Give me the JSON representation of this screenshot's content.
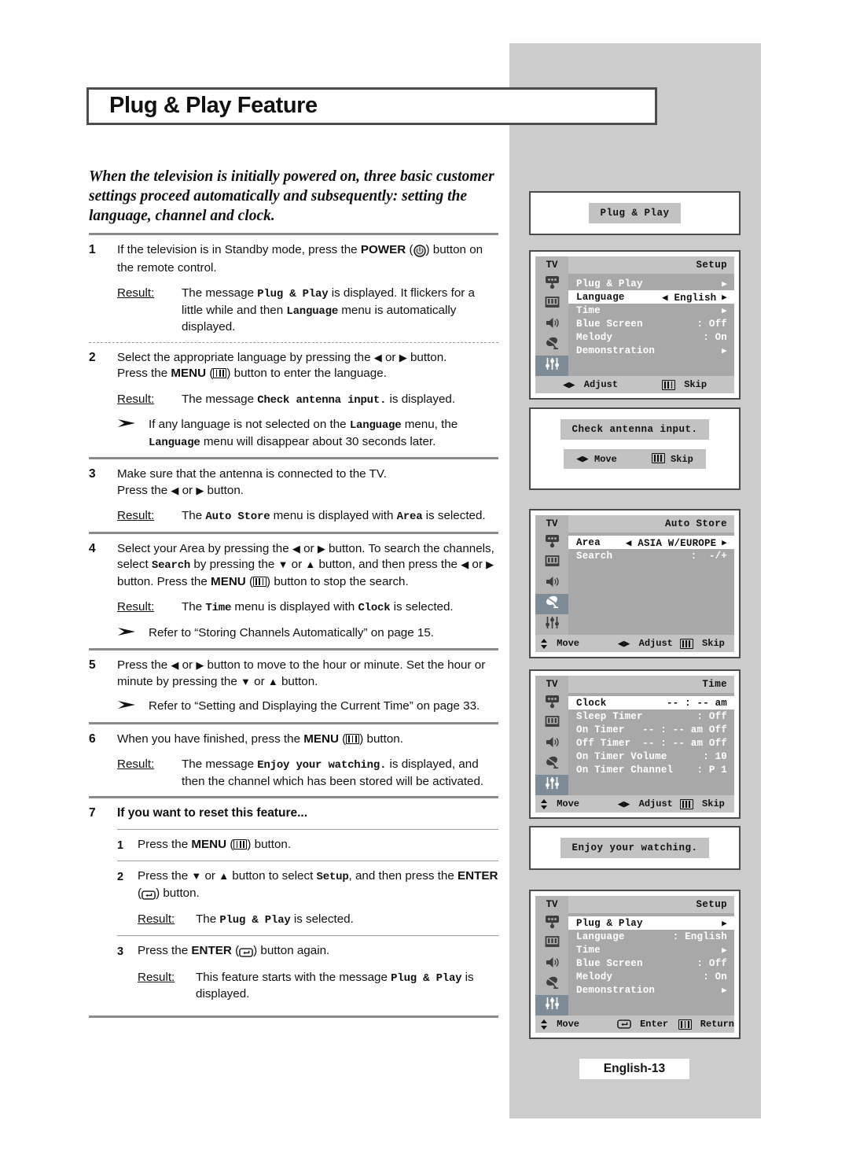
{
  "page": {
    "title": "Plug & Play Feature",
    "footer": "English-13",
    "intro": "When the television is initially powered on, three basic customer settings proceed automatically and subsequently: setting the language, channel and clock."
  },
  "icons": {
    "menu": "menu-icon",
    "enter": "enter-icon",
    "power": "power-icon",
    "left": "◀",
    "right": "▶",
    "up": "▲",
    "down": "▼",
    "updown": "↕",
    "note": "note-arrow-icon"
  },
  "steps": [
    {
      "num": "1",
      "text_a": "If the television is in Standby mode, press the ",
      "bold_a": "POWER",
      "icon_a": "power",
      "text_b": " button on the remote control.",
      "result_label": "Result:",
      "result_parts": [
        {
          "t": "The message ",
          "k": "n"
        },
        {
          "t": "Plug & Play",
          "k": "m"
        },
        {
          "t": " is displayed. It flickers for a little while and then ",
          "k": "n"
        },
        {
          "t": "Language",
          "k": "m"
        },
        {
          "t": " menu is automatically displayed.",
          "k": "n"
        }
      ]
    },
    {
      "num": "2",
      "line1_parts": [
        {
          "t": "Select the appropriate language by pressing the ",
          "k": "n"
        },
        {
          "t": "◀",
          "k": "a"
        },
        {
          "t": " or ",
          "k": "n"
        },
        {
          "t": "▶",
          "k": "a"
        },
        {
          "t": " button.",
          "k": "n"
        }
      ],
      "line2_pre": "Press the ",
      "line2_bold": "MENU",
      "line2_post": " button to enter the language.",
      "result_label": "Result:",
      "result_parts": [
        {
          "t": "The message ",
          "k": "n"
        },
        {
          "t": "Check antenna input.",
          "k": "m"
        },
        {
          "t": " is displayed.",
          "k": "n"
        }
      ],
      "note_parts": [
        {
          "t": "If any language is not selected on the ",
          "k": "n"
        },
        {
          "t": "Language",
          "k": "m"
        },
        {
          "t": " menu, the ",
          "k": "n"
        },
        {
          "t": "Language",
          "k": "m"
        },
        {
          "t": " menu will disappear about 30 seconds later.",
          "k": "n"
        }
      ]
    },
    {
      "num": "3",
      "line1": "Make sure that the antenna is connected to the TV.",
      "line2_parts": [
        {
          "t": "Press the ",
          "k": "n"
        },
        {
          "t": "◀",
          "k": "a"
        },
        {
          "t": " or ",
          "k": "n"
        },
        {
          "t": "▶",
          "k": "a"
        },
        {
          "t": " button.",
          "k": "n"
        }
      ],
      "result_label": "Result:",
      "result_parts": [
        {
          "t": "The ",
          "k": "n"
        },
        {
          "t": "Auto Store",
          "k": "m"
        },
        {
          "t": " menu is displayed with ",
          "k": "n"
        },
        {
          "t": "Area",
          "k": "m"
        },
        {
          "t": " is selected.",
          "k": "n"
        }
      ]
    },
    {
      "num": "4",
      "body_parts": [
        {
          "t": "Select your Area by pressing the ",
          "k": "n"
        },
        {
          "t": "◀",
          "k": "a"
        },
        {
          "t": " or ",
          "k": "n"
        },
        {
          "t": "▶",
          "k": "a"
        },
        {
          "t": " button. To search the channels, select ",
          "k": "n"
        },
        {
          "t": "Search",
          "k": "m"
        },
        {
          "t": " by pressing the ",
          "k": "n"
        },
        {
          "t": "▼",
          "k": "a"
        },
        {
          "t": " or ",
          "k": "n"
        },
        {
          "t": "▲",
          "k": "a"
        },
        {
          "t": " button, and then press the ",
          "k": "n"
        },
        {
          "t": "◀",
          "k": "a"
        },
        {
          "t": " or ",
          "k": "n"
        },
        {
          "t": "▶",
          "k": "a"
        },
        {
          "t": " button. Press the ",
          "k": "n"
        },
        {
          "t": "MENU",
          "k": "b"
        },
        {
          "t": "MENUICON",
          "k": "i"
        },
        {
          "t": " button to stop the search.",
          "k": "n"
        }
      ],
      "result_label": "Result:",
      "result_parts": [
        {
          "t": "The ",
          "k": "n"
        },
        {
          "t": "Time",
          "k": "m"
        },
        {
          "t": " menu is displayed with ",
          "k": "n"
        },
        {
          "t": "Clock",
          "k": "m"
        },
        {
          "t": " is selected.",
          "k": "n"
        }
      ],
      "note_parts": [
        {
          "t": "Refer to “Storing Channels Automatically” on page 15.",
          "k": "n"
        }
      ]
    },
    {
      "num": "5",
      "body_parts": [
        {
          "t": "Press the ",
          "k": "n"
        },
        {
          "t": "◀",
          "k": "a"
        },
        {
          "t": " or ",
          "k": "n"
        },
        {
          "t": "▶",
          "k": "a"
        },
        {
          "t": " button to move to the hour or minute. Set the hour or minute by pressing the ",
          "k": "n"
        },
        {
          "t": "▼",
          "k": "a"
        },
        {
          "t": " or ",
          "k": "n"
        },
        {
          "t": "▲",
          "k": "a"
        },
        {
          "t": " button.",
          "k": "n"
        }
      ],
      "note_parts": [
        {
          "t": "Refer to “Setting and Displaying the Current Time” on page 33.",
          "k": "n"
        }
      ]
    },
    {
      "num": "6",
      "body_pre": "When you have finished, press the ",
      "body_bold": "MENU",
      "body_post": " button.",
      "result_label": "Result:",
      "result_parts": [
        {
          "t": "The message ",
          "k": "n"
        },
        {
          "t": "Enjoy your watching.",
          "k": "m"
        },
        {
          "t": " is displayed, and then the channel which has been stored will be activated.",
          "k": "n"
        }
      ]
    }
  ],
  "step7": {
    "num": "7",
    "headline": "If you want to reset this feature...",
    "substeps": [
      {
        "num": "1",
        "pre": "Press the ",
        "bold": "MENU",
        "post": " button."
      },
      {
        "num": "2",
        "parts": [
          {
            "t": "Press the ",
            "k": "n"
          },
          {
            "t": "▼",
            "k": "a"
          },
          {
            "t": " or ",
            "k": "n"
          },
          {
            "t": "▲",
            "k": "a"
          },
          {
            "t": " button to select ",
            "k": "n"
          },
          {
            "t": "Setup",
            "k": "m"
          },
          {
            "t": ", and then press the ",
            "k": "n"
          },
          {
            "t": "ENTER",
            "k": "b"
          },
          {
            "t": "ENTERICON",
            "k": "i"
          },
          {
            "t": " button.",
            "k": "n"
          }
        ],
        "result_label": "Result:",
        "result_parts": [
          {
            "t": "The ",
            "k": "n"
          },
          {
            "t": "Plug & Play",
            "k": "m"
          },
          {
            "t": " is selected.",
            "k": "n"
          }
        ]
      },
      {
        "num": "3",
        "parts": [
          {
            "t": "Press the ",
            "k": "n"
          },
          {
            "t": "ENTER",
            "k": "b"
          },
          {
            "t": "ENTERICON",
            "k": "i"
          },
          {
            "t": " button again.",
            "k": "n"
          }
        ],
        "result_label": "Result:",
        "result_parts": [
          {
            "t": "This feature starts with the message ",
            "k": "n"
          },
          {
            "t": "Plug & Play",
            "k": "m"
          },
          {
            "t": " is displayed.",
            "k": "n"
          }
        ]
      }
    ]
  },
  "osd": {
    "plug_play_msg": {
      "message": "Plug & Play"
    },
    "setup_menu_1": {
      "tv_label": "TV",
      "title": "Setup",
      "rows": [
        {
          "label": "Plug & Play",
          "value": "",
          "caret": "▶",
          "highlight": false
        },
        {
          "label": "Language",
          "value": "◀ English",
          "caret": "▶",
          "highlight": true
        },
        {
          "label": "Time",
          "value": "",
          "caret": "▶",
          "highlight": false
        },
        {
          "label": "Blue Screen",
          "value": ": Off",
          "caret": "",
          "highlight": false
        },
        {
          "label": "Melody",
          "value": ": On",
          "caret": "",
          "highlight": false
        },
        {
          "label": "Demonstration",
          "value": "",
          "caret": "▶",
          "highlight": false
        }
      ],
      "selected_rail": 4,
      "footer": [
        {
          "icon": "◀▶",
          "label": "Adjust"
        },
        {
          "icon": "menu",
          "label": "Skip"
        }
      ]
    },
    "check_antenna": {
      "message": "Check antenna input.",
      "footer": [
        {
          "icon": "◀▶",
          "label": "Move"
        },
        {
          "icon": "menu",
          "label": "Skip"
        }
      ]
    },
    "auto_store_menu": {
      "tv_label": "TV",
      "title": "Auto Store",
      "rows": [
        {
          "label": "Area",
          "value": "◀ ASIA W/EUROPE",
          "caret": "▶",
          "highlight": true
        },
        {
          "label": "Search",
          "value": ":  -/+",
          "caret": "",
          "highlight": false
        }
      ],
      "selected_rail": 3,
      "footer": [
        {
          "icon": "↕",
          "label": "Move"
        },
        {
          "icon": "◀▶",
          "label": "Adjust"
        },
        {
          "icon": "menu",
          "label": "Skip"
        }
      ]
    },
    "time_menu": {
      "tv_label": "TV",
      "title": "Time",
      "rows": [
        {
          "label": "Clock",
          "value": "-- : -- am",
          "caret": "",
          "highlight": true
        },
        {
          "label": "Sleep Timer",
          "value": ": Off",
          "caret": "",
          "highlight": false
        },
        {
          "label": "On Timer",
          "value": "-- : -- am Off",
          "caret": "",
          "highlight": false
        },
        {
          "label": "Off Timer",
          "value": "-- : -- am Off",
          "caret": "",
          "highlight": false
        },
        {
          "label": "On Timer Volume",
          "value": ": 10",
          "caret": "",
          "highlight": false
        },
        {
          "label": "On Timer Channel",
          "value": ": P 1",
          "caret": "",
          "highlight": false
        }
      ],
      "selected_rail": 4,
      "footer": [
        {
          "icon": "↕",
          "label": "Move"
        },
        {
          "icon": "◀▶",
          "label": "Adjust"
        },
        {
          "icon": "menu",
          "label": "Skip"
        }
      ]
    },
    "enjoy_msg": {
      "message": "Enjoy your watching."
    },
    "setup_menu_2": {
      "tv_label": "TV",
      "title": "Setup",
      "rows": [
        {
          "label": "Plug & Play",
          "value": "",
          "caret": "▶",
          "highlight": true
        },
        {
          "label": "Language",
          "value": ": English",
          "caret": "",
          "highlight": false
        },
        {
          "label": "Time",
          "value": "",
          "caret": "▶",
          "highlight": false
        },
        {
          "label": "Blue Screen",
          "value": ": Off",
          "caret": "",
          "highlight": false
        },
        {
          "label": "Melody",
          "value": ": On",
          "caret": "",
          "highlight": false
        },
        {
          "label": "Demonstration",
          "value": "",
          "caret": "▶",
          "highlight": false
        }
      ],
      "selected_rail": 4,
      "footer": [
        {
          "icon": "↕",
          "label": "Move"
        },
        {
          "icon": "enter",
          "label": "Enter"
        },
        {
          "icon": "menu",
          "label": "Return"
        }
      ]
    }
  },
  "colors": {
    "grey_panel": "#cccccc",
    "osd_body": "#a8a8a8",
    "osd_header": "#c4c4c4",
    "osd_rail": "#b4b4b4",
    "osd_selected": "#7d8c96",
    "rule": "#8a8a8a"
  }
}
